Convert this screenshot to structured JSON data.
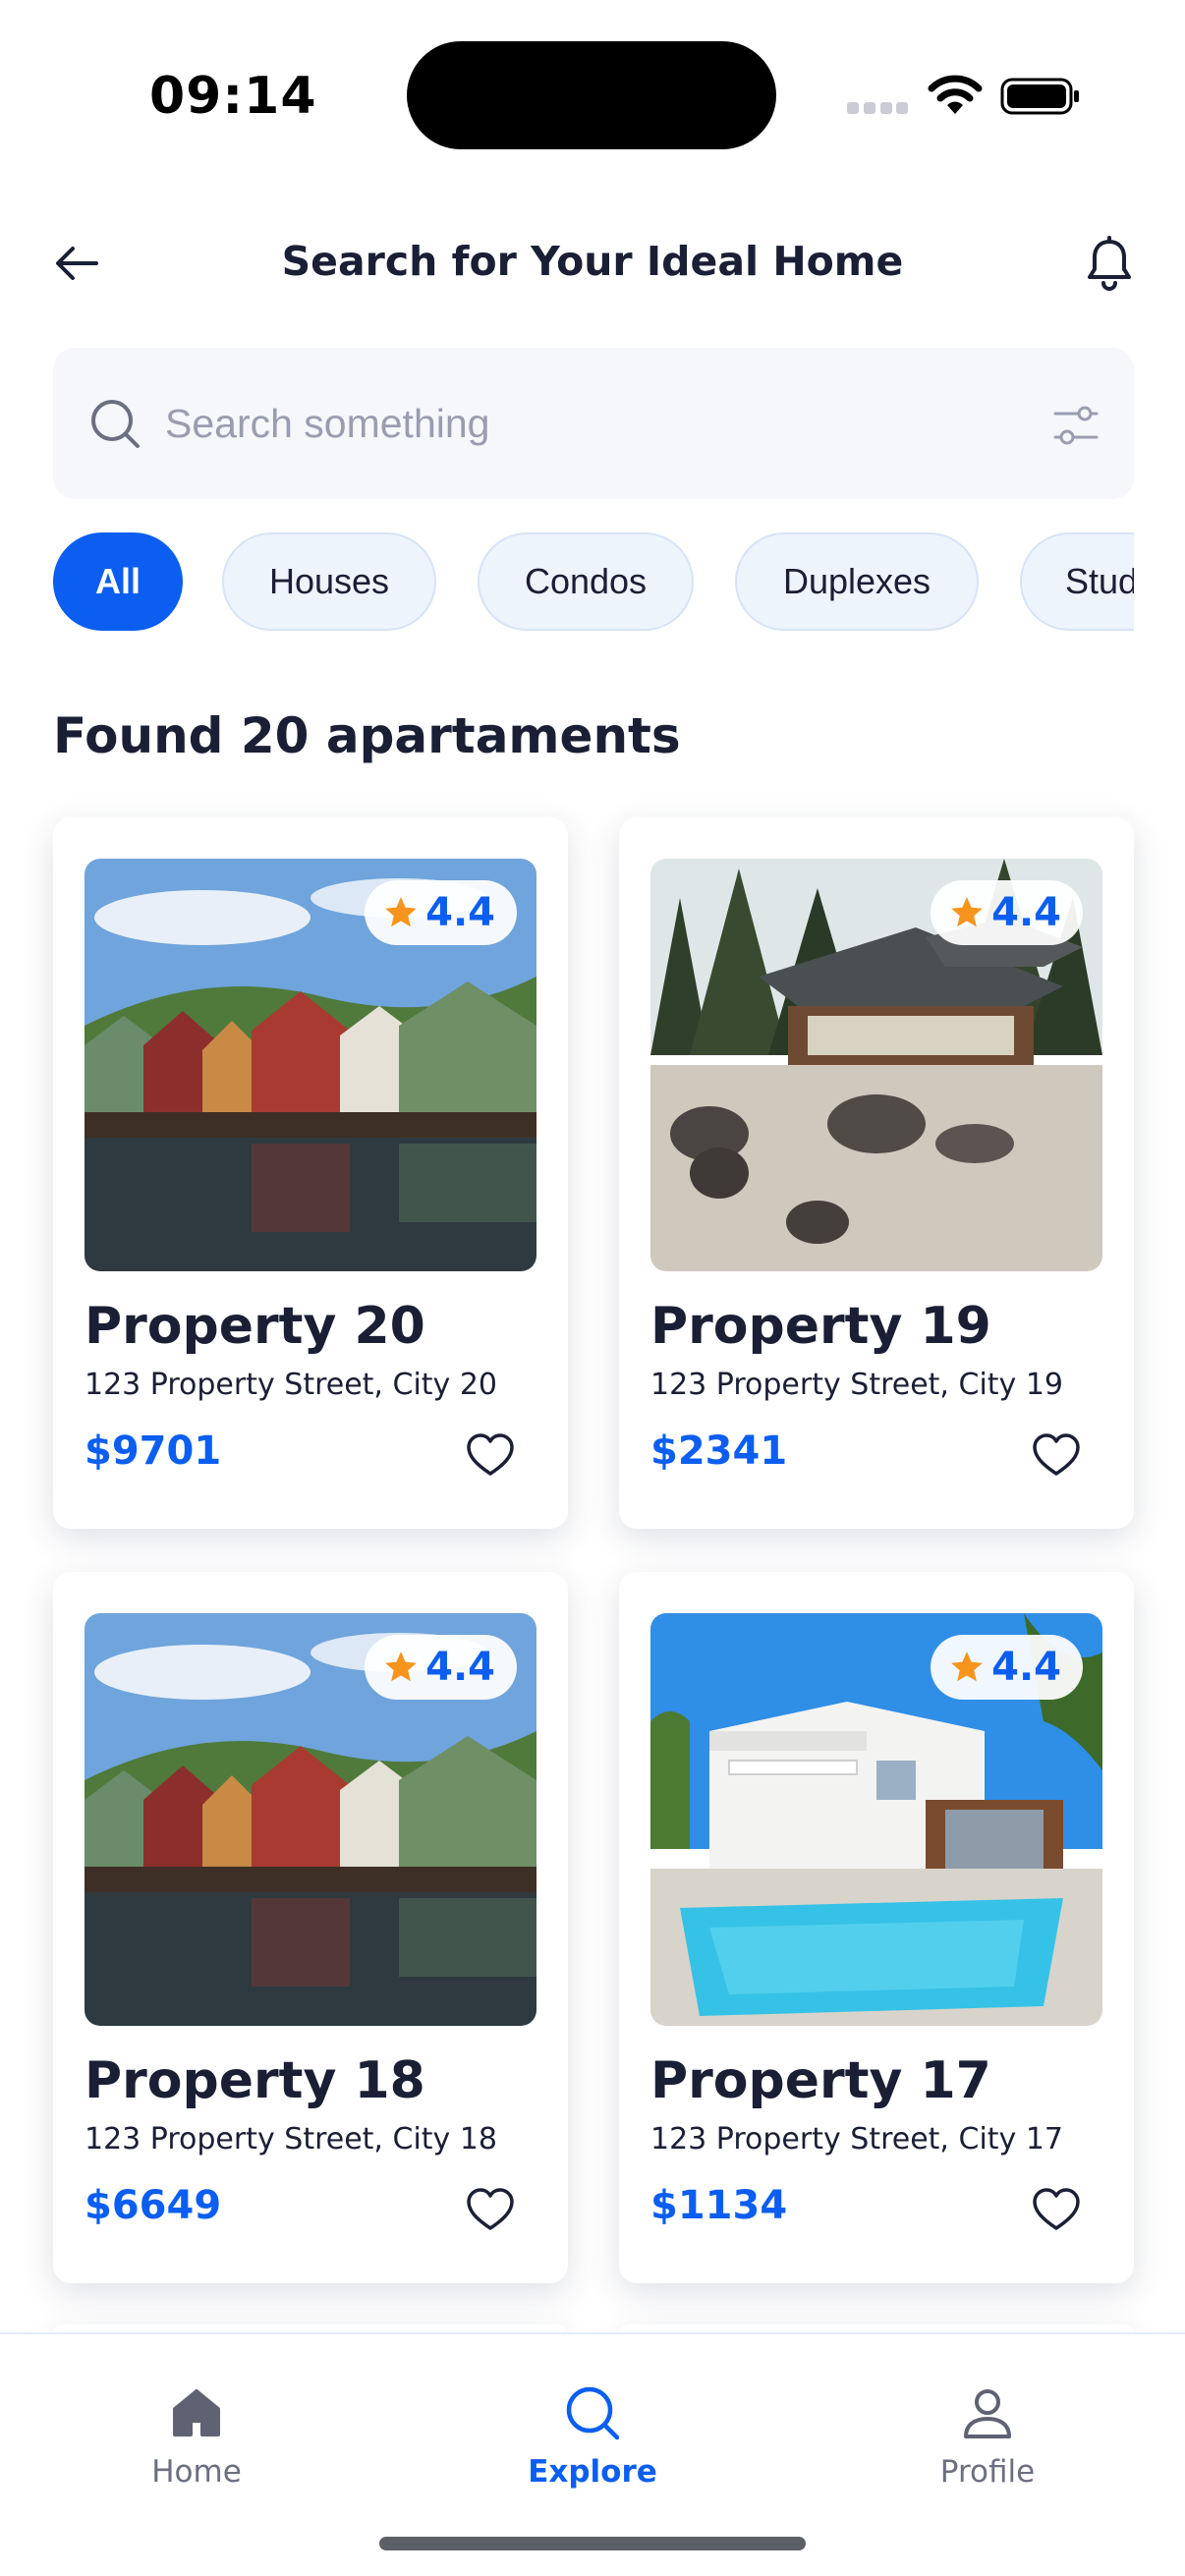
{
  "status_bar": {
    "time": "09:14"
  },
  "header": {
    "title": "Search for Your Ideal Home"
  },
  "search": {
    "placeholder": "Search something"
  },
  "categories": [
    {
      "label": "All",
      "active": true
    },
    {
      "label": "Houses",
      "active": false
    },
    {
      "label": "Condos",
      "active": false
    },
    {
      "label": "Duplexes",
      "active": false
    },
    {
      "label": "Studios",
      "active": false
    }
  ],
  "results": {
    "title": "Found 20 apartaments"
  },
  "properties": [
    {
      "name": "Property 20",
      "address": "123 Property Street, City 20",
      "price": "$9701",
      "rating": "4.4",
      "image": "waterfront-houses"
    },
    {
      "name": "Property 19",
      "address": "123 Property Street, City 19",
      "price": "$2341",
      "rating": "4.4",
      "image": "japanese-garden"
    },
    {
      "name": "Property 18",
      "address": "123 Property Street, City 18",
      "price": "$6649",
      "rating": "4.4",
      "image": "waterfront-houses"
    },
    {
      "name": "Property 17",
      "address": "123 Property Street, City 17",
      "price": "$1134",
      "rating": "4.4",
      "image": "pool-house"
    }
  ],
  "bottom_nav": [
    {
      "label": "Home",
      "icon": "home-icon",
      "active": false
    },
    {
      "label": "Explore",
      "icon": "explore-icon",
      "active": true
    },
    {
      "label": "Profile",
      "icon": "profile-icon",
      "active": false
    }
  ],
  "colors": {
    "accent": "#0b5ef0",
    "text": "#1b1f35",
    "chip_bg": "#eef4fc",
    "search_bg": "#f6f7fb",
    "star": "#f7941d"
  }
}
